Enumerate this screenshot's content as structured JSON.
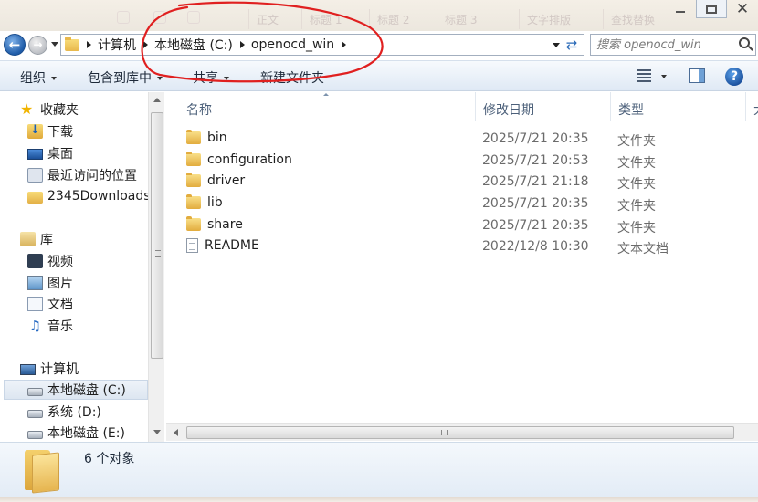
{
  "background_tabs": [
    "正文",
    "标题 1",
    "标题 2",
    "标题 3",
    "文字排版",
    "查找替换"
  ],
  "window_controls": {
    "minimize": "–",
    "maximize": "□",
    "close": "✕"
  },
  "address": {
    "crumbs": [
      "计算机",
      "本地磁盘 (C:)",
      "openocd_win"
    ]
  },
  "search": {
    "placeholder": "搜索 openocd_win"
  },
  "toolbar": {
    "organize": "组织",
    "include_in_library": "包含到库中",
    "share": "共享",
    "new_folder": "新建文件夹",
    "help": "?"
  },
  "nav": {
    "favorites": {
      "label": "收藏夹",
      "items": [
        "下载",
        "桌面",
        "最近访问的位置",
        "2345Downloads"
      ]
    },
    "libraries": {
      "label": "库",
      "items": [
        "视频",
        "图片",
        "文档",
        "音乐"
      ]
    },
    "computer": {
      "label": "计算机",
      "items": [
        "本地磁盘 (C:)",
        "系统 (D:)",
        "本地磁盘 (E:)"
      ]
    }
  },
  "columns": {
    "name": "名称",
    "modified": "修改日期",
    "type": "类型",
    "size": "大"
  },
  "files": [
    {
      "name": "bin",
      "modified": "2025/7/21 20:35",
      "type": "文件夹",
      "icon": "folder-icon"
    },
    {
      "name": "configuration",
      "modified": "2025/7/21 20:53",
      "type": "文件夹",
      "icon": "folder-icon"
    },
    {
      "name": "driver",
      "modified": "2025/7/21 21:18",
      "type": "文件夹",
      "icon": "folder-icon"
    },
    {
      "name": "lib",
      "modified": "2025/7/21 20:35",
      "type": "文件夹",
      "icon": "folder-icon"
    },
    {
      "name": "share",
      "modified": "2025/7/21 20:35",
      "type": "文件夹",
      "icon": "folder-icon"
    },
    {
      "name": "README",
      "modified": "2022/12/8 10:30",
      "type": "文本文档",
      "icon": "text-file-icon"
    }
  ],
  "status": {
    "item_count": "6 个对象"
  },
  "colors": {
    "annotation": "#e02020",
    "accent": "#1f5ca8"
  }
}
